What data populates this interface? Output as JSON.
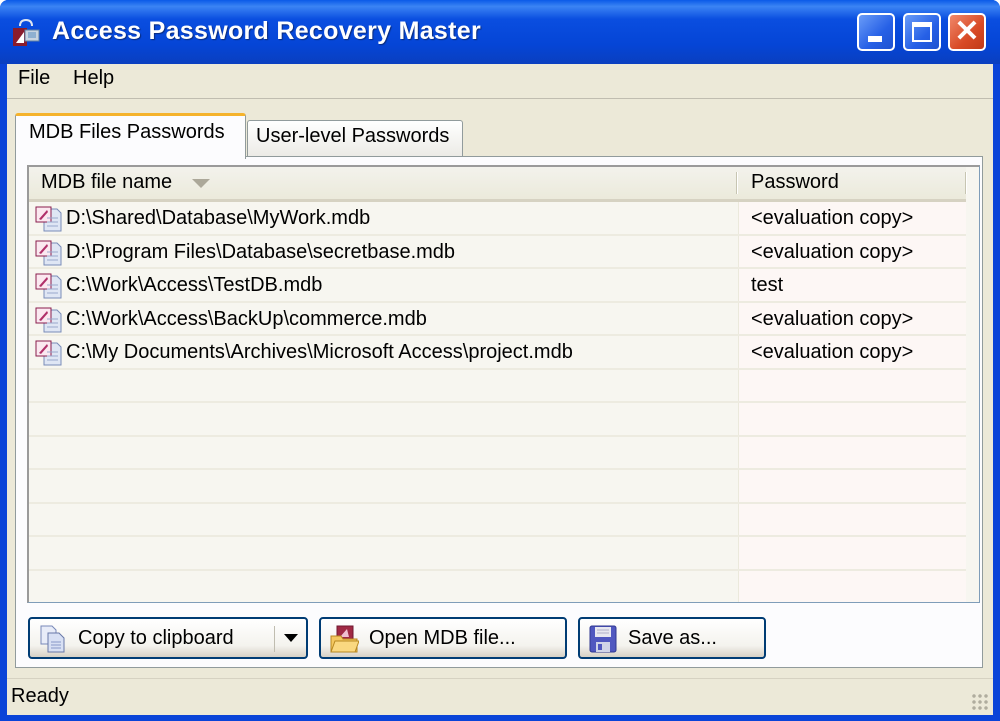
{
  "window": {
    "title": "Access Password Recovery Master",
    "controls": {
      "minimize": "minimize",
      "maximize": "maximize",
      "close": "✕"
    }
  },
  "menu": {
    "items": [
      {
        "label": "File"
      },
      {
        "label": "Help"
      }
    ]
  },
  "tabs": [
    {
      "label": "MDB Files Passwords",
      "active": true
    },
    {
      "label": "User-level Passwords",
      "active": false
    }
  ],
  "table": {
    "columns": [
      {
        "label": "MDB file name",
        "sorted": "descending"
      },
      {
        "label": "Password"
      }
    ],
    "rows": [
      {
        "icon": "access-mdb-file-icon",
        "file": "D:\\Shared\\Database\\MyWork.mdb",
        "password": "<evaluation copy>"
      },
      {
        "icon": "access-mdb-file-icon",
        "file": "D:\\Program Files\\Database\\secretbase.mdb",
        "password": "<evaluation copy>"
      },
      {
        "icon": "access-mdb-file-icon",
        "file": "C:\\Work\\Access\\TestDB.mdb",
        "password": "test"
      },
      {
        "icon": "access-mdb-file-icon",
        "file": "C:\\Work\\Access\\BackUp\\commerce.mdb",
        "password": "<evaluation copy>"
      },
      {
        "icon": "access-mdb-file-icon",
        "file": "C:\\My Documents\\Archives\\Microsoft Access\\project.mdb",
        "password": "<evaluation copy>"
      }
    ],
    "empty_rows": 7
  },
  "buttons": {
    "copy": {
      "label": "Copy to clipboard",
      "icon": "copy-icon"
    },
    "open": {
      "label": "Open MDB file...",
      "icon": "open-folder-icon"
    },
    "save": {
      "label": "Save as...",
      "icon": "floppy-disk-icon"
    }
  },
  "status": {
    "text": "Ready"
  },
  "colors": {
    "titlebar": "#0a4ee0",
    "tab_highlight": "#f5b32c",
    "close_button": "#d84a26",
    "button_border": "#003c74"
  }
}
